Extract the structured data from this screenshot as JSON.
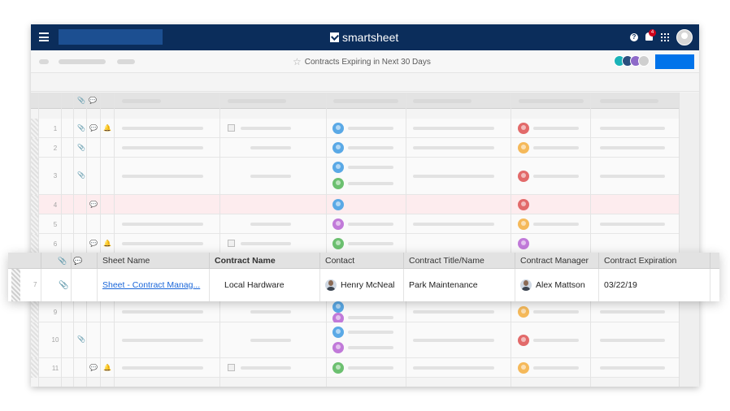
{
  "app": {
    "logo_text": "smartsheet",
    "notification_count": "4"
  },
  "toolbar": {
    "sheet_title": "Contracts Expiring in Next 30 Days"
  },
  "grid": {
    "row_numbers": [
      "1",
      "2",
      "3",
      "4",
      "5",
      "6",
      "9",
      "10",
      "11"
    ]
  },
  "overlay": {
    "columns": [
      "Sheet Name",
      "Contract Name",
      "Contact",
      "Contract Title/Name",
      "Contract Manager",
      "Contract Expiration"
    ],
    "row": {
      "number": "7",
      "sheet_name": "Sheet - Contract Manag...",
      "contract_name": "Local Hardware",
      "contact": "Henry McNeal",
      "contract_title": "Park Maintenance",
      "contract_manager": "Alex Mattson",
      "contract_expiration": "03/22/19"
    }
  },
  "colors": {
    "topbar": "#0b2d5b",
    "accent": "#0073ea",
    "avatar_blue": "#5aa9e6",
    "avatar_green": "#6cc070",
    "avatar_purple": "#c17ad9",
    "avatar_red": "#e26a6a",
    "avatar_orange": "#f5b95a",
    "row_highlight": "#fdecee"
  }
}
